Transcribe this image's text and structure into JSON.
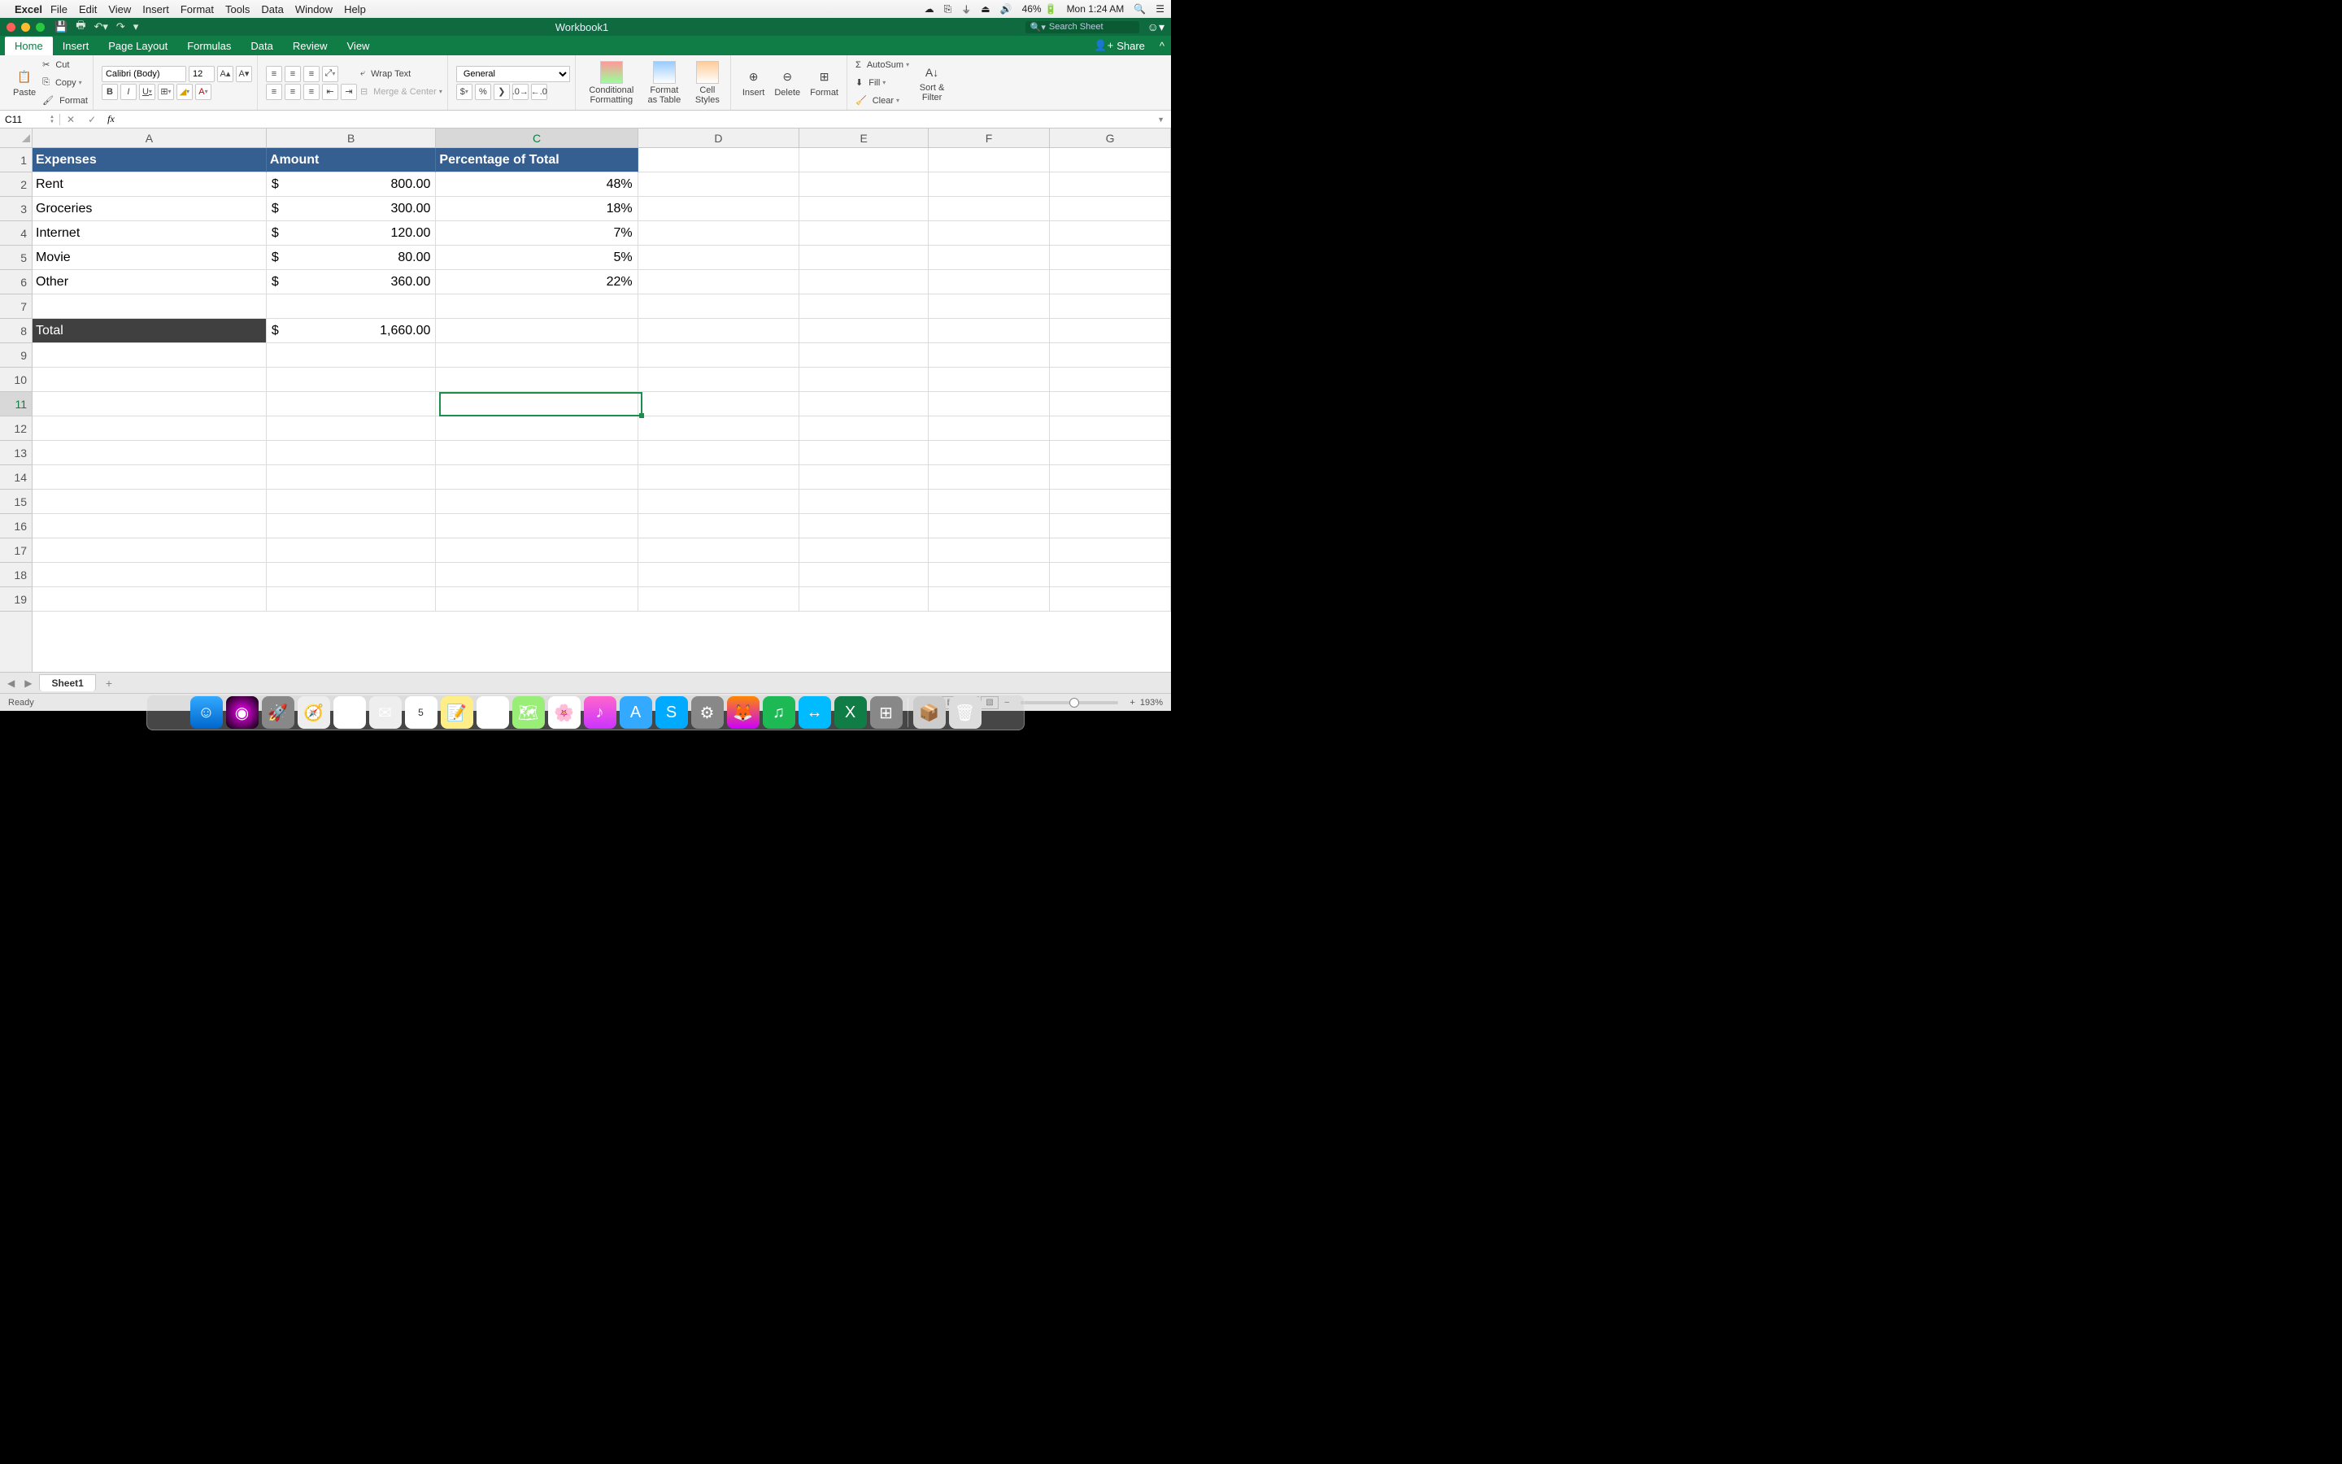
{
  "menubar": {
    "app": "Excel",
    "items": [
      "File",
      "Edit",
      "View",
      "Insert",
      "Format",
      "Tools",
      "Data",
      "Window",
      "Help"
    ],
    "battery": "46%",
    "clock": "Mon 1:24 AM"
  },
  "titlebar": {
    "title": "Workbook1",
    "search_placeholder": "Search Sheet"
  },
  "ribbon_tabs": [
    "Home",
    "Insert",
    "Page Layout",
    "Formulas",
    "Data",
    "Review",
    "View"
  ],
  "active_tab": "Home",
  "share_label": "Share",
  "ribbon": {
    "paste": "Paste",
    "cut": "Cut",
    "copy": "Copy",
    "format_painter": "Format",
    "font_name": "Calibri (Body)",
    "font_size": "12",
    "wrap": "Wrap Text",
    "merge": "Merge & Center",
    "number_format": "General",
    "cond_fmt": "Conditional Formatting",
    "fmt_table": "Format as Table",
    "cell_styles": "Cell Styles",
    "insert": "Insert",
    "delete": "Delete",
    "format": "Format",
    "autosum": "AutoSum",
    "fill": "Fill",
    "clear": "Clear",
    "sort_filter": "Sort & Filter"
  },
  "namebox": "C11",
  "formula": "",
  "columns": [
    "A",
    "B",
    "C",
    "D",
    "E",
    "F",
    "G"
  ],
  "selected_col": "C",
  "selected_row": 11,
  "rows": [
    1,
    2,
    3,
    4,
    5,
    6,
    7,
    8,
    9,
    10,
    11,
    12,
    13,
    14,
    15,
    16,
    17,
    18,
    19
  ],
  "data": {
    "headers": [
      "Expenses",
      "Amount",
      "Percentage of Total"
    ],
    "rows": [
      {
        "a": "Rent",
        "b": "800.00",
        "c": "48%"
      },
      {
        "a": "Groceries",
        "b": "300.00",
        "c": "18%"
      },
      {
        "a": "Internet",
        "b": "120.00",
        "c": "7%"
      },
      {
        "a": "Movie",
        "b": "80.00",
        "c": "5%"
      },
      {
        "a": "Other",
        "b": "360.00",
        "c": "22%"
      }
    ],
    "total_label": "Total",
    "total_amount": "1,660.00"
  },
  "sheet_tab": "Sheet1",
  "status": "Ready",
  "zoom": "193%",
  "dock_apps": [
    "finder",
    "siri",
    "launchpad",
    "safari",
    "chrome",
    "mail",
    "calendar",
    "notes",
    "reminders",
    "maps",
    "photos",
    "itunes",
    "appstore",
    "skype",
    "sysprefs",
    "firefox",
    "spotify",
    "zoom",
    "excel",
    "word",
    "keychain",
    "trash"
  ]
}
